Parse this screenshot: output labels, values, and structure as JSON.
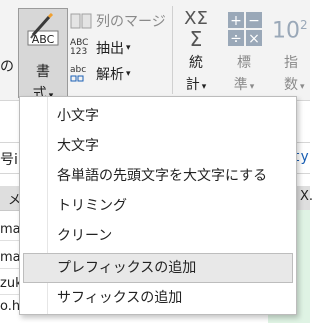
{
  "ribbon": {
    "edge_left_label": "の",
    "format_button": {
      "icon": "abc-format-icon",
      "label": "書",
      "sublabel": "式"
    },
    "merge_columns": {
      "icon": "merge-columns-icon",
      "label": "列のマージ"
    },
    "extract": {
      "icon": "extract-icon",
      "icon_text": "ABC\n123",
      "label": "抽出"
    },
    "parse": {
      "icon": "parse-icon",
      "icon_text": "abc",
      "label": "解析"
    },
    "statistics": {
      "icon": "sigma-icon",
      "label": "統",
      "sublabel": "計"
    },
    "standard": {
      "icon": "calculator-icon",
      "label": "標",
      "sublabel": "準"
    },
    "scientific": {
      "icon": "power-icon",
      "icon_text": "10",
      "icon_sup": "2",
      "label": "指",
      "sublabel": "数"
    },
    "abc_text": "ABC"
  },
  "formula_bar": {
    "left_text": "号i",
    "right_text": "ty"
  },
  "column_header": {
    "left_text": "メ",
    "right_text": "X."
  },
  "rows": [
    "mak",
    "ma",
    "zuk",
    "o.h"
  ],
  "menu": {
    "items": [
      "小文字",
      "大文字",
      "各単語の先頭文字を大文字にする",
      "トリミング",
      "クリーン",
      "プレフィックスの追加",
      "サフィックスの追加"
    ],
    "hovered_index": 5
  }
}
